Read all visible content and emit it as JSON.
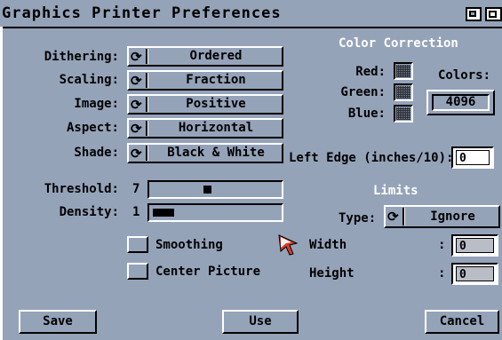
{
  "window": {
    "title": "Graphics Printer Preferences"
  },
  "settings": {
    "dithering": {
      "label": "Dithering:",
      "value": "Ordered"
    },
    "scaling": {
      "label": "Scaling:",
      "value": "Fraction"
    },
    "image": {
      "label": "Image:",
      "value": "Positive"
    },
    "aspect": {
      "label": "Aspect:",
      "value": "Horizontal"
    },
    "shade": {
      "label": "Shade:",
      "value": "Black & White"
    }
  },
  "threshold": {
    "label": "Threshold:",
    "value": "7",
    "level": 0.43
  },
  "density": {
    "label": "Density:",
    "value": "1",
    "level": 0.0
  },
  "checkboxes": {
    "smoothing": {
      "label": "Smoothing",
      "checked": false
    },
    "center": {
      "label": "Center Picture",
      "checked": false
    }
  },
  "color_correction": {
    "heading": "Color Correction",
    "red_label": "Red:",
    "green_label": "Green:",
    "blue_label": "Blue:",
    "colors_label": "Colors:",
    "colors_value": "4096"
  },
  "left_edge": {
    "label": "Left Edge (inches/10):",
    "value": "0"
  },
  "limits": {
    "heading": "Limits",
    "type_label": "Type:",
    "type_value": "Ignore",
    "width_label": "Width",
    "height_label": "Height",
    "colon": ":",
    "width_value": "0",
    "height_value": "0"
  },
  "buttons": {
    "save": "Save",
    "use": "Use",
    "cancel": "Cancel"
  },
  "icons": {
    "cycle_glyph": "⟳"
  },
  "colors": {
    "background": "#95a3b9",
    "highlight": "#ffffff",
    "shadow": "#000000",
    "pointer": "#d23c2c"
  }
}
